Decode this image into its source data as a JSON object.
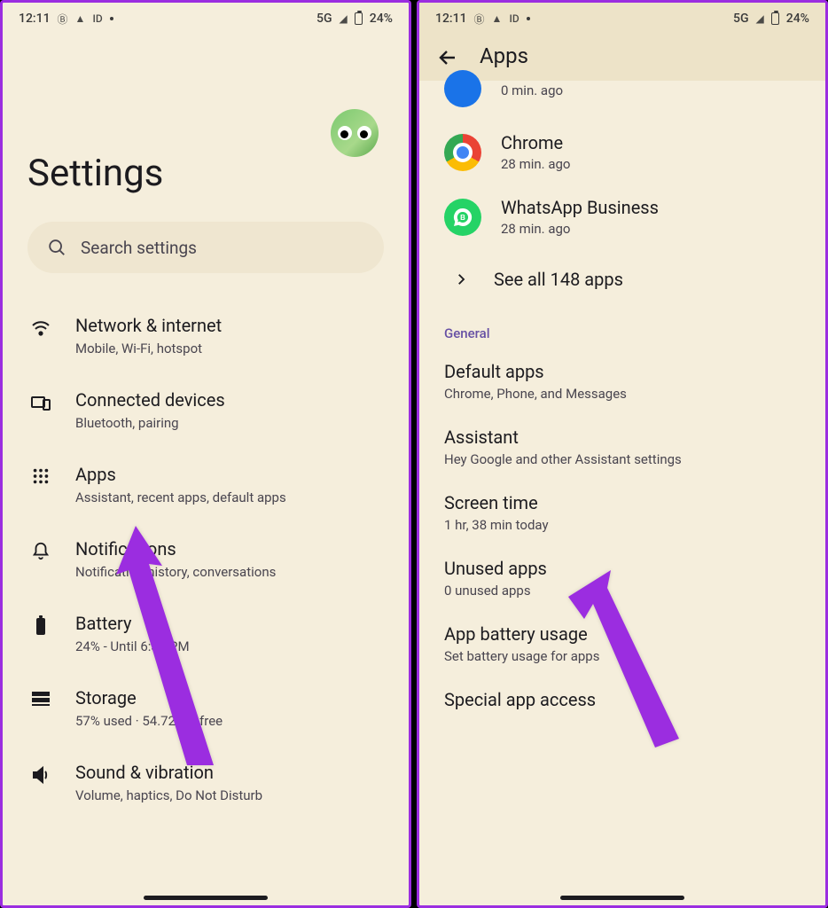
{
  "status": {
    "time": "12:11",
    "network": "5G",
    "battery_pct": "24%"
  },
  "left": {
    "title": "Settings",
    "search_placeholder": "Search settings",
    "items": [
      {
        "title": "Network & internet",
        "subtitle": "Mobile, Wi-Fi, hotspot"
      },
      {
        "title": "Connected devices",
        "subtitle": "Bluetooth, pairing"
      },
      {
        "title": "Apps",
        "subtitle": "Assistant, recent apps, default apps"
      },
      {
        "title": "Notifications",
        "subtitle": "Notification history, conversations"
      },
      {
        "title": "Battery",
        "subtitle": "24% - Until 6:30 PM"
      },
      {
        "title": "Storage",
        "subtitle": "57% used · 54.72 GB free"
      },
      {
        "title": "Sound & vibration",
        "subtitle": "Volume, haptics, Do Not Disturb"
      }
    ]
  },
  "right": {
    "appbar_title": "Apps",
    "recent": [
      {
        "name_partial_subtitle": "0 min. ago"
      },
      {
        "name": "Chrome",
        "subtitle": "28 min. ago"
      },
      {
        "name": "WhatsApp Business",
        "subtitle": "28 min. ago"
      }
    ],
    "see_all": "See all 148 apps",
    "section_label": "General",
    "general": [
      {
        "title": "Default apps",
        "subtitle": "Chrome, Phone, and Messages"
      },
      {
        "title": "Assistant",
        "subtitle": "Hey Google and other Assistant settings"
      },
      {
        "title": "Screen time",
        "subtitle": "1 hr, 38 min today"
      },
      {
        "title": "Unused apps",
        "subtitle": "0 unused apps"
      },
      {
        "title": "App battery usage",
        "subtitle": "Set battery usage for apps"
      },
      {
        "title": "Special app access",
        "subtitle": ""
      }
    ]
  }
}
